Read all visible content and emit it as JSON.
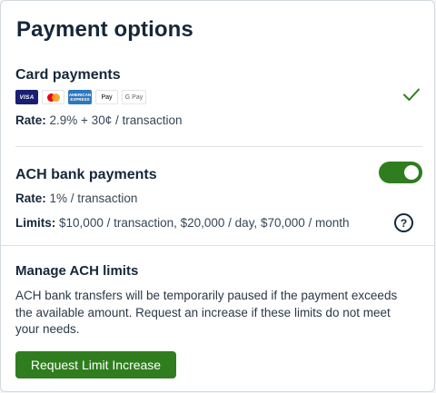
{
  "header": {
    "title": "Payment options"
  },
  "card_payments": {
    "title": "Card payments",
    "logos": [
      {
        "name": "visa-logo",
        "text": "VISA"
      },
      {
        "name": "mastercard-logo",
        "text": ""
      },
      {
        "name": "amex-logo",
        "text": "AMERICAN EXPRESS"
      },
      {
        "name": "apple-pay-logo",
        "text": "Pay"
      },
      {
        "name": "google-pay-logo",
        "text": "G Pay"
      }
    ],
    "rate_label": "Rate:",
    "rate_value": "2.9% + 30¢ / transaction",
    "status_icon": "checkmark-icon",
    "enabled": true
  },
  "ach_payments": {
    "title": "ACH bank payments",
    "toggle_on": true,
    "rate_label": "Rate:",
    "rate_value": "1% / transaction",
    "limits_label": "Limits:",
    "limits_value": "$10,000 / transaction, $20,000 / day, $70,000 / month",
    "help_glyph": "?"
  },
  "manage_limits": {
    "title": "Manage ACH limits",
    "description": "ACH bank transfers will be temporarily paused if the payment exceeds the available amount. Request an increase if these limits do not meet your needs.",
    "button_label": "Request Limit Increase"
  },
  "colors": {
    "accent_green": "#2f7d1e",
    "text_dark": "#16273a",
    "divider": "#dde1e5"
  }
}
